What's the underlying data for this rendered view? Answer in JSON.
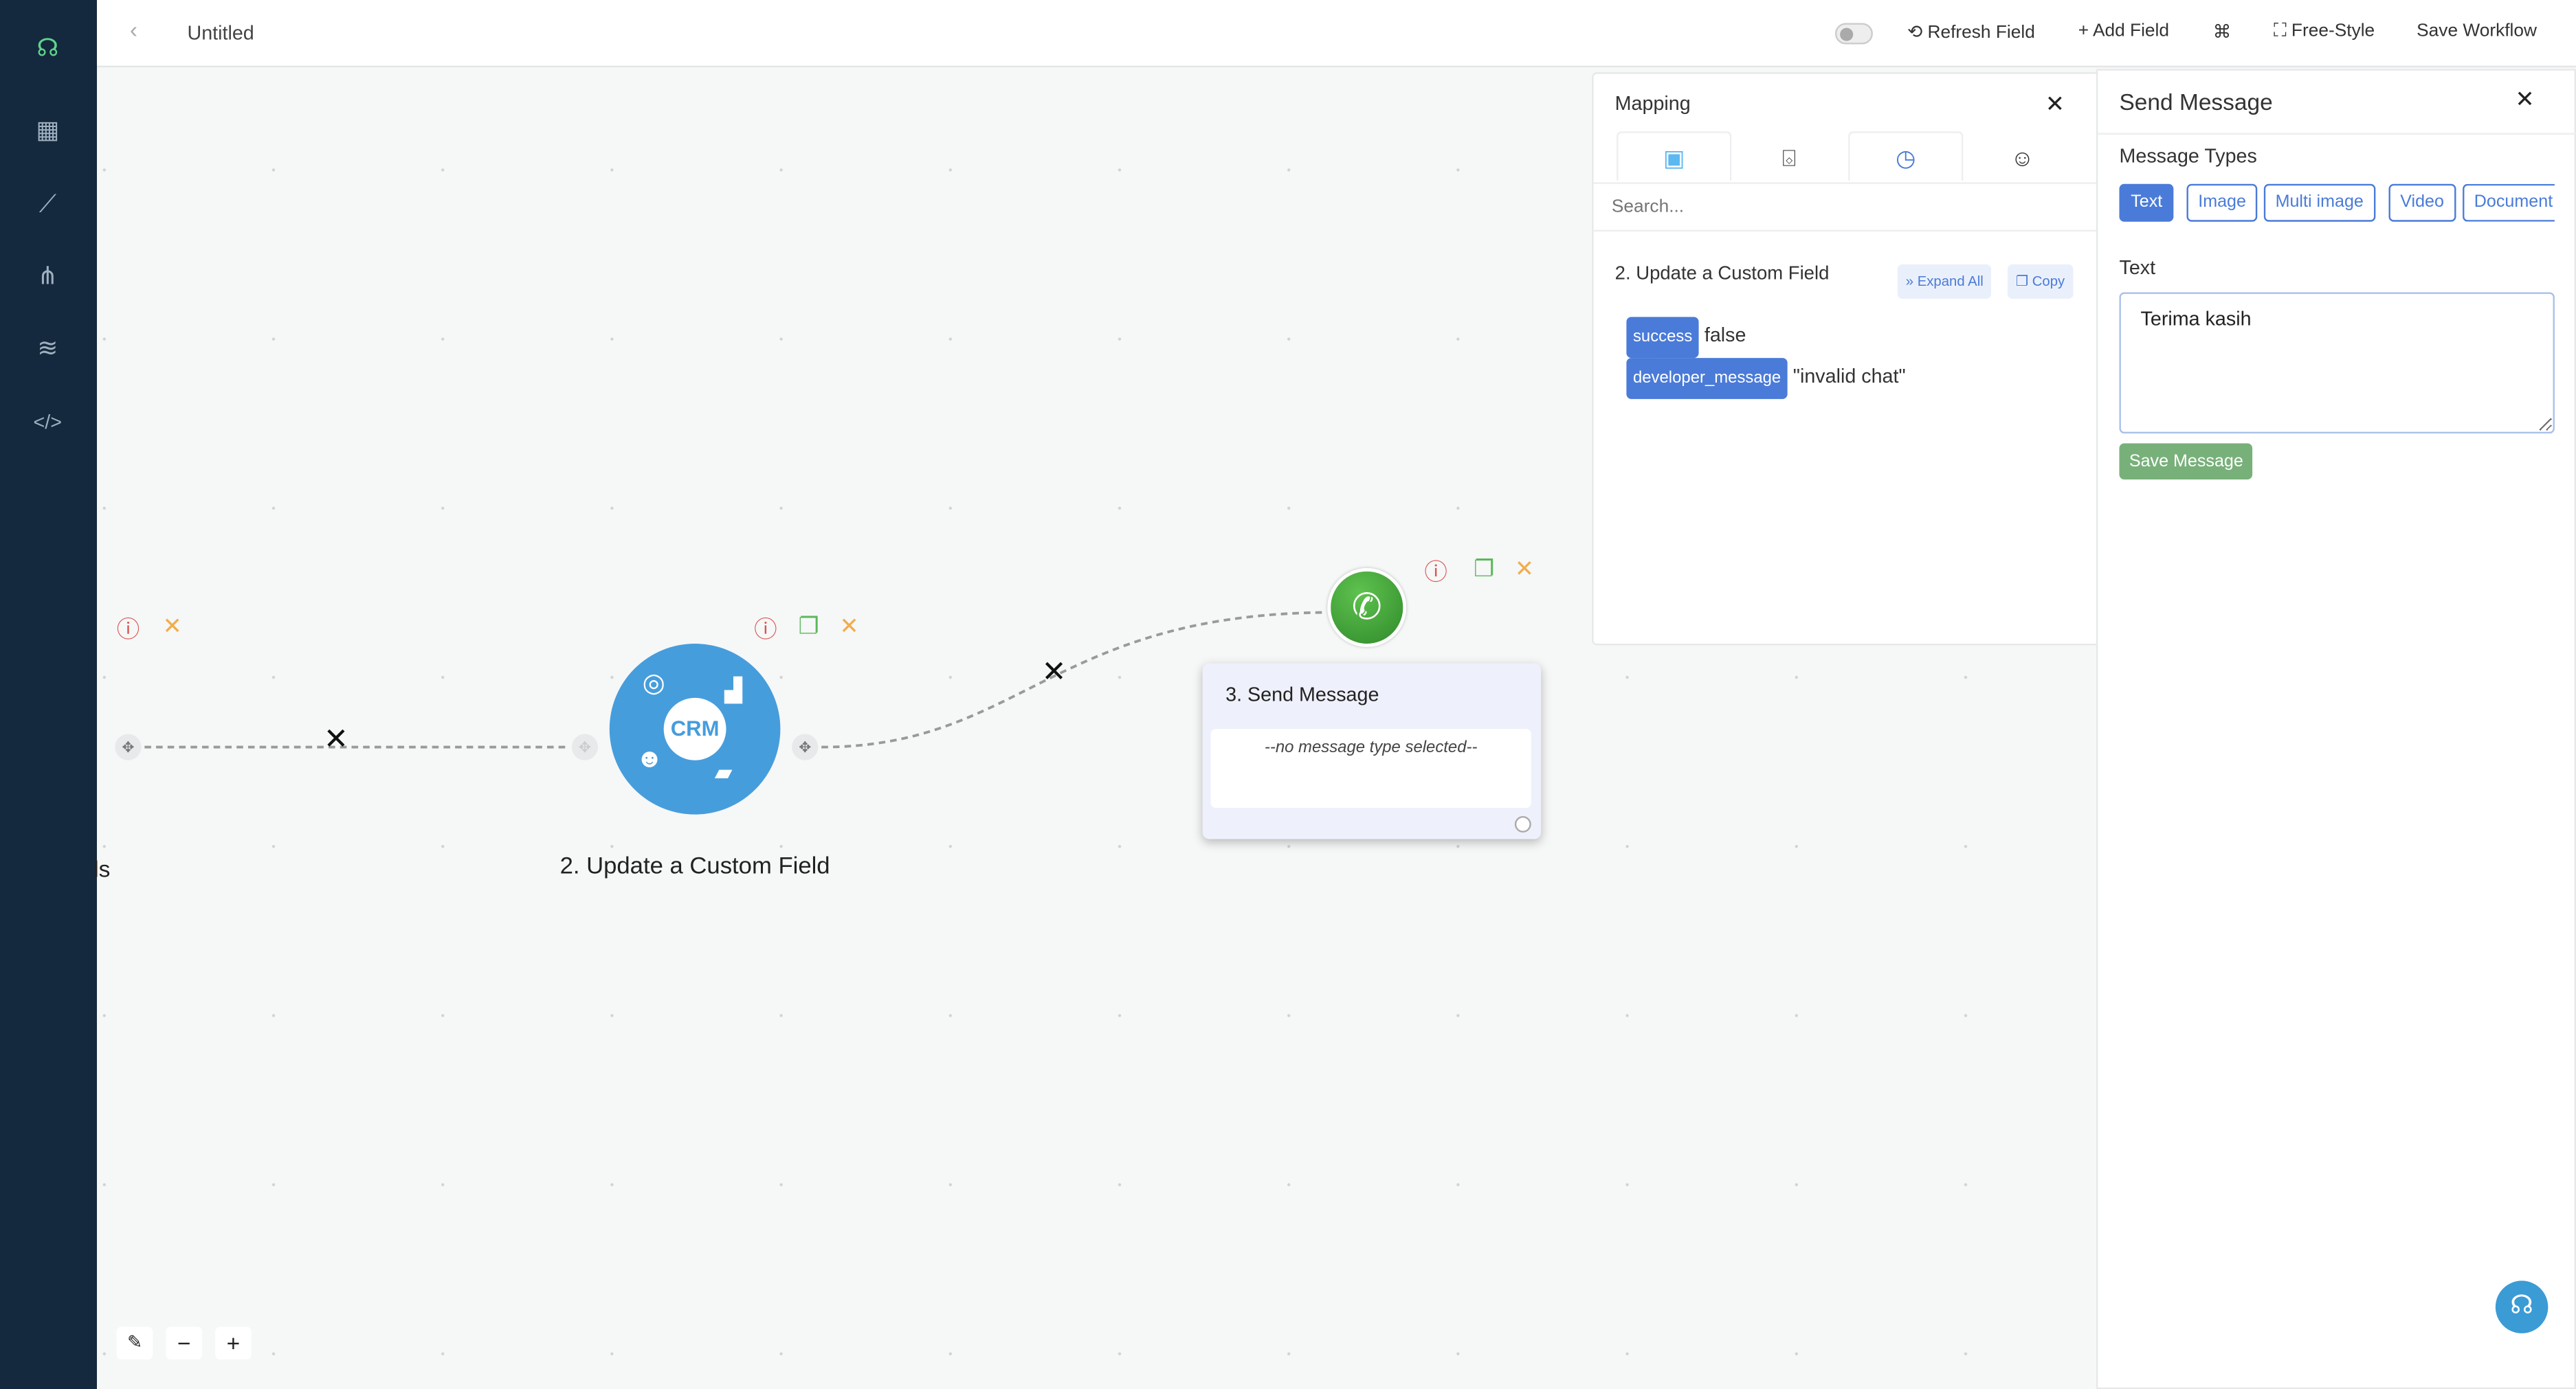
{
  "topbar": {
    "title": "Untitled",
    "refresh_field": "Refresh Field",
    "add_field": "Add Field",
    "free_style": "Free-Style",
    "save_workflow": "Save Workflow",
    "toggle_on": false
  },
  "sidebar": {
    "items": [
      "logo",
      "dashboard",
      "analytics",
      "workflows",
      "database",
      "code"
    ]
  },
  "canvas": {
    "prev_node_label_fragment": "ls",
    "node2": {
      "label": "2. Update a Custom Field",
      "icon_text": "CRM"
    },
    "node3": {
      "title": "3. Send Message",
      "body": "--no message type selected--"
    },
    "zoom_controls": {
      "minus": "−",
      "plus": "+"
    }
  },
  "mapping": {
    "title": "Mapping",
    "tabs": [
      "contact-icon",
      "bot-icon",
      "history-icon",
      "emoji-icon"
    ],
    "search_placeholder": "Search...",
    "section_title": "2. Update a Custom Field",
    "expand_all": "Expand All",
    "copy": "Copy",
    "fields": [
      {
        "key": "success",
        "value": "false"
      },
      {
        "key": "developer_message",
        "value": "\"invalid chat\""
      }
    ]
  },
  "send_message": {
    "title": "Send Message",
    "message_types_label": "Message Types",
    "types": [
      "Text",
      "Image",
      "Multi image",
      "Video",
      "Document"
    ],
    "selected_type": "Text",
    "text_label": "Text",
    "text_value": "Terima kasih",
    "save_button": "Save Message"
  },
  "colors": {
    "sidebar": "#14293d",
    "accent": "#4a7bd8",
    "save": "#78b07a",
    "crm": "#469ddc",
    "whatsapp": "#43a33a"
  }
}
